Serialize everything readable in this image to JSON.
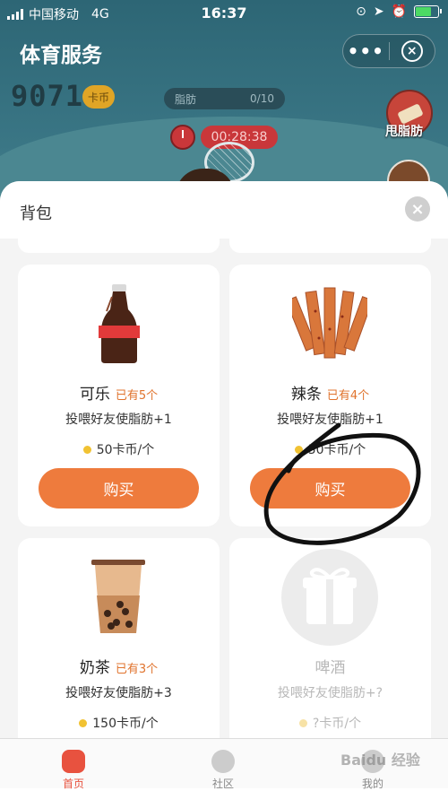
{
  "status_bar": {
    "carrier": "中国移动",
    "network": "4G",
    "time": "16:37"
  },
  "app": {
    "title": "体育服务"
  },
  "game": {
    "coins": "9071",
    "coin_badge": "卡币",
    "fat_label": "脂肪",
    "fat_value": "0/10",
    "timer": "00:28:38",
    "shake_label": "甩脂肪"
  },
  "backpack": {
    "title": "背包",
    "items": [
      {
        "name": "可乐",
        "owned": "已有5个",
        "effect": "投喂好友使脂肪+1",
        "price": "50卡币/个",
        "buy_label": "购买"
      },
      {
        "name": "辣条",
        "owned": "已有4个",
        "effect": "投喂好友使脂肪+1",
        "price": "50卡币/个",
        "buy_label": "购买"
      },
      {
        "name": "奶茶",
        "owned": "已有3个",
        "effect": "投喂好友使脂肪+3",
        "price": "150卡币/个"
      },
      {
        "name": "啤酒",
        "effect": "投喂好友使脂肪+?",
        "price": "?卡币/个"
      }
    ]
  },
  "tabbar": {
    "tabs": [
      {
        "label": "首页"
      },
      {
        "label": "社区"
      },
      {
        "label": "我的"
      }
    ]
  },
  "watermark": "Baidu 经验",
  "colors": {
    "accent": "#ee7b3d",
    "owned_text": "#e0732d",
    "tab_active": "#e8523f"
  }
}
